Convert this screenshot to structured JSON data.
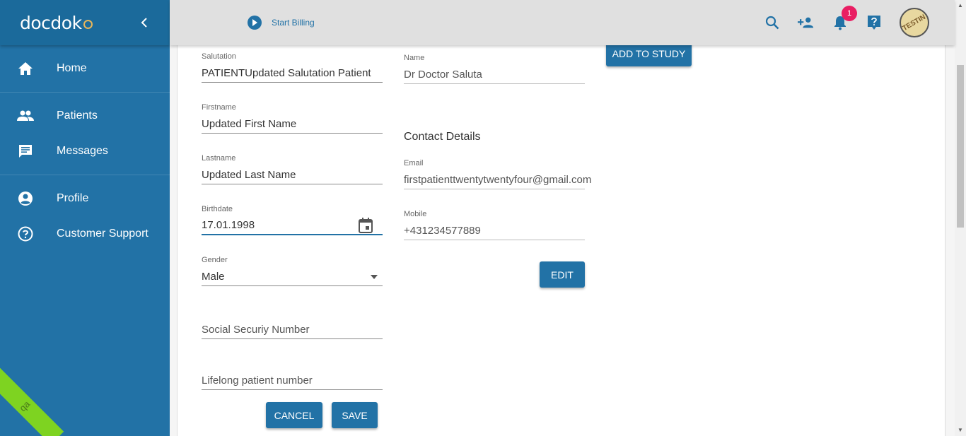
{
  "app": {
    "logo": "docdok",
    "env_badge": "qa"
  },
  "sidebar": {
    "items": [
      {
        "label": "Home",
        "icon": "home-icon"
      },
      {
        "label": "Patients",
        "icon": "people-icon"
      },
      {
        "label": "Messages",
        "icon": "message-icon"
      },
      {
        "label": "Profile",
        "icon": "account-circle-icon"
      },
      {
        "label": "Customer Support",
        "icon": "help-circle-icon"
      }
    ]
  },
  "topbar": {
    "billing_label": "Start Billing",
    "notification_count": "1",
    "avatar_text": "TESTIN"
  },
  "form": {
    "salutation": {
      "label": "Salutation",
      "value": "PATIENTUpdated Salutation Patient"
    },
    "firstname": {
      "label": "Firstname",
      "value": "Updated First Name"
    },
    "lastname": {
      "label": "Lastname",
      "value": "Updated Last Name"
    },
    "birthdate": {
      "label": "Birthdate",
      "value": "17.01.1998"
    },
    "gender": {
      "label": "Gender",
      "value": "Male"
    },
    "ssn": {
      "placeholder": "Social Securiy Number"
    },
    "lifelong": {
      "placeholder": "Lifelong patient number"
    },
    "cancel_label": "CANCEL",
    "save_label": "SAVE"
  },
  "doctor": {
    "name_label": "Name",
    "name_value": "Dr Doctor Saluta",
    "add_to_study_label": "ADD TO STUDY"
  },
  "contact": {
    "title": "Contact Details",
    "email_label": "Email",
    "email_value": "firstpatienttwentytwentyfour@gmail.com",
    "mobile_label": "Mobile",
    "mobile_value": "+431234577889",
    "edit_label": "EDIT"
  },
  "colors": {
    "primary": "#2272a6",
    "badge": "#e91e63",
    "qa": "#7ed321"
  }
}
